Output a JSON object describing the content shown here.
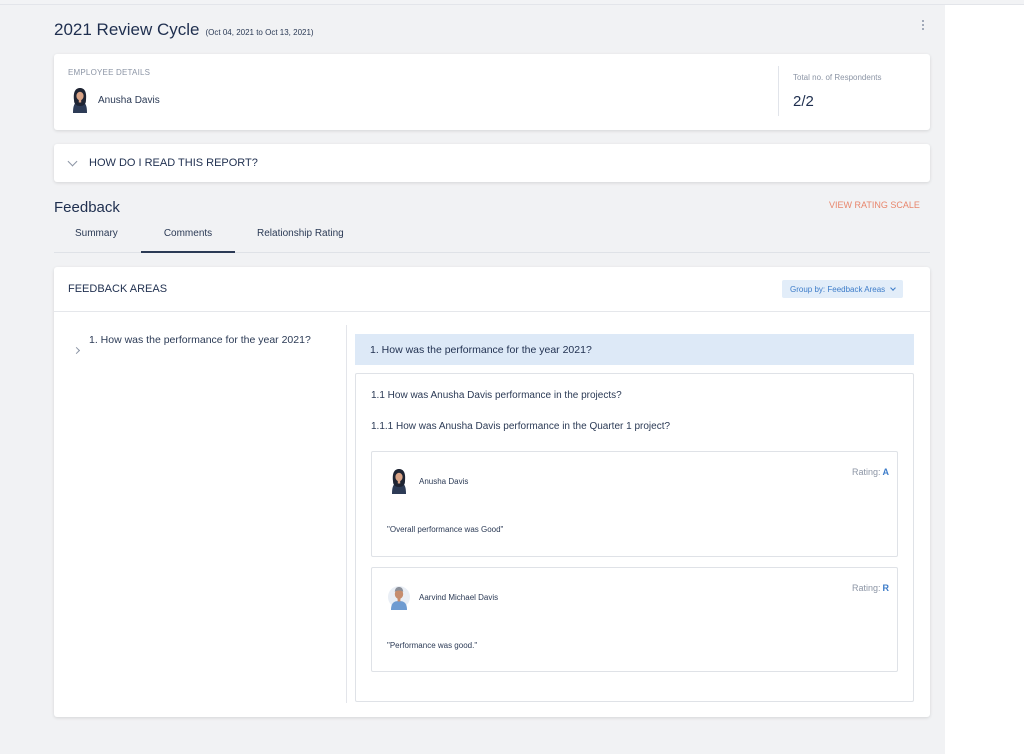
{
  "review": {
    "title": "2021 Review Cycle",
    "date_range": "(Oct 04, 2021 to Oct 13, 2021)"
  },
  "employee": {
    "section_label": "EMPLOYEE DETAILS",
    "name": "Anusha Davis",
    "respondents_label": "Total no. of Respondents",
    "respondents_value": "2/2"
  },
  "howto": {
    "label": "HOW DO I READ THIS REPORT?"
  },
  "feedback": {
    "title": "Feedback",
    "rating_scale_link": "VIEW RATING SCALE",
    "tabs": [
      {
        "label": "Summary",
        "active": false
      },
      {
        "label": "Comments",
        "active": true
      },
      {
        "label": "Relationship Rating",
        "active": false
      }
    ]
  },
  "areas": {
    "title": "FEEDBACK AREAS",
    "group_by": "Group by: Feedback Areas",
    "tree": [
      {
        "label": "1. How was the performance for the year 2021?"
      }
    ],
    "question": {
      "title": "1. How was the performance for the year 2021?",
      "sub": "1.1 How was Anusha Davis performance in the projects?",
      "subsub": "1.1.1 How was Anusha Davis performance in the Quarter 1 project?",
      "rating_label": "Rating",
      "responses": [
        {
          "name": "Anusha Davis",
          "rating": "A",
          "comment": "\"Overall performance was Good\""
        },
        {
          "name": "Aarvind Michael Davis",
          "rating": "R",
          "comment": "\"Performance was good.\""
        }
      ]
    }
  }
}
